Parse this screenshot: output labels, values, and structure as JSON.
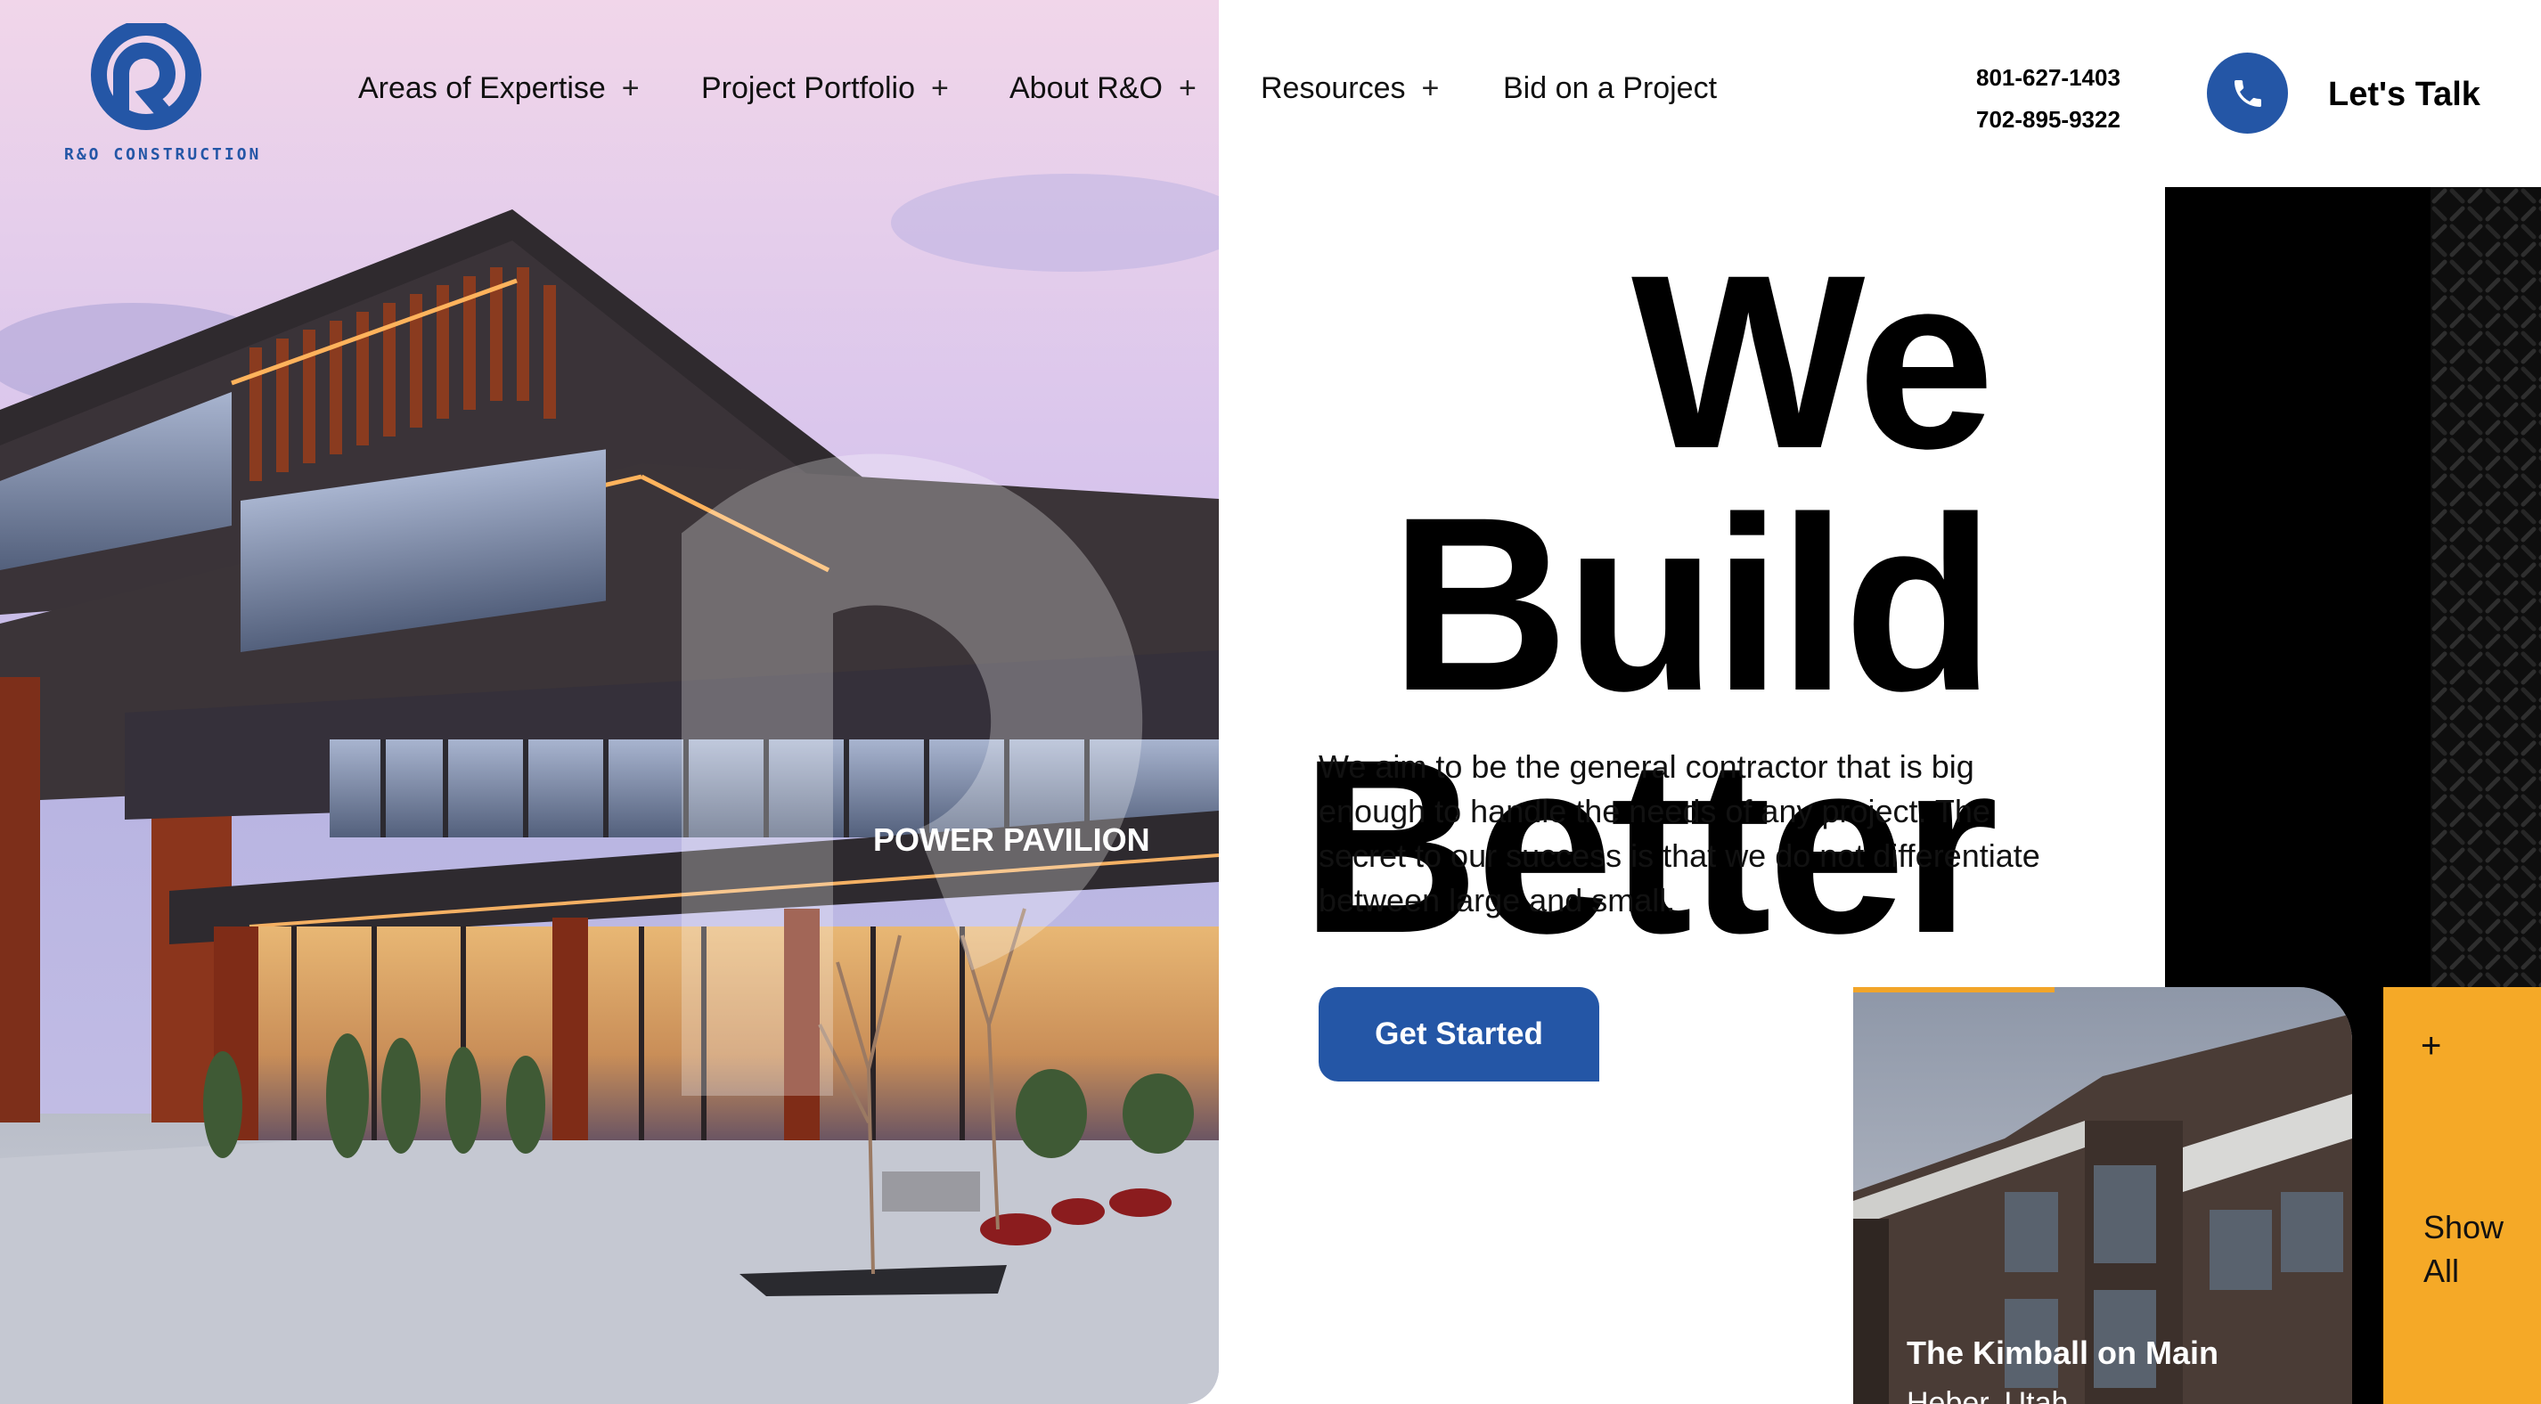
{
  "brand": {
    "logo_text": "R&O CONSTRUCTION",
    "primary_color": "#2456a6",
    "accent_color": "#f5a927"
  },
  "nav": {
    "items": [
      {
        "label": "Areas of Expertise",
        "has_submenu": true,
        "plus": "+"
      },
      {
        "label": "Project Portfolio",
        "has_submenu": true,
        "plus": "+"
      },
      {
        "label": "About R&O",
        "has_submenu": true,
        "plus": "+"
      },
      {
        "label": "Resources",
        "has_submenu": true,
        "plus": "+"
      },
      {
        "label": "Bid on a Project",
        "has_submenu": false,
        "plus": ""
      }
    ]
  },
  "contact": {
    "phones": [
      "801-627-1403",
      "702-895-9322"
    ],
    "call_icon": "phone-icon",
    "cta_label": "Let's Talk"
  },
  "hero": {
    "headline_line1": "We Build",
    "headline_line2": "Better",
    "intro": "We aim to be the general contractor that is big enough to handle the needs of any project. The secret to our success is that we do not differentiate between large and small.",
    "button_label": "Get Started",
    "building_sign": "POWER PAVILION"
  },
  "project_card": {
    "title": "The Kimball on Main",
    "subtitle": "Heber, Utah"
  },
  "show_all": {
    "plus": "+",
    "label": "Show All"
  }
}
